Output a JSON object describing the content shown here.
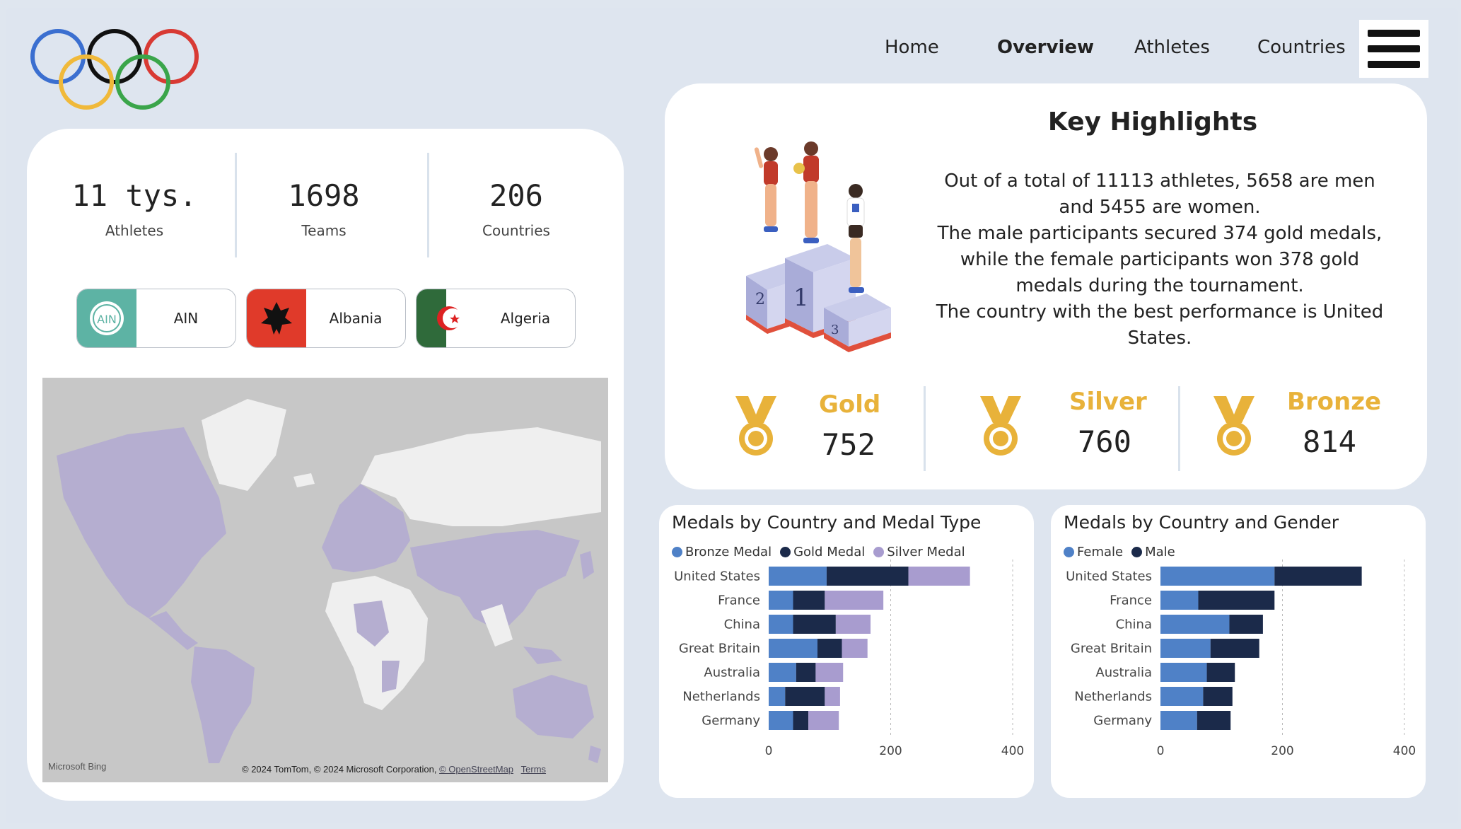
{
  "nav": {
    "items": [
      {
        "label": "Home",
        "active": false
      },
      {
        "label": "Overview",
        "active": true
      },
      {
        "label": "Athletes",
        "active": false
      },
      {
        "label": "Countries",
        "active": false
      }
    ]
  },
  "kpis": [
    {
      "value": "11 tys.",
      "label": "Athletes"
    },
    {
      "value": "1698",
      "label": "Teams"
    },
    {
      "value": "206",
      "label": "Countries"
    }
  ],
  "country_chips": [
    {
      "name": "AIN",
      "flag_color": "#5db3a4"
    },
    {
      "name": "Albania",
      "flag_color": "#e03a2a"
    },
    {
      "name": "Algeria",
      "flag_color": "#2f6a3a"
    }
  ],
  "map": {
    "provider": "Microsoft Bing",
    "attribution": "© 2024 TomTom, © 2024 Microsoft Corporation,",
    "osm_link": "© OpenStreetMap",
    "terms_link": "Terms"
  },
  "highlights": {
    "title": "Key Highlights",
    "lines": [
      "Out of a total of 11113 athletes, 5658 are men and 5455 are women.",
      "The male participants secured 374 gold medals, while the female participants won 378 gold medals during the tournament.",
      "The country with the best performance is United States."
    ],
    "medals": [
      {
        "label": "Gold",
        "value": "752"
      },
      {
        "label": "Silver",
        "value": "760"
      },
      {
        "label": "Bronze",
        "value": "814"
      }
    ]
  },
  "colors": {
    "bronze_medal": "#4f81c7",
    "gold_medal": "#1b2a4a",
    "silver_medal": "#a89ccf",
    "female": "#4f81c7",
    "male": "#1b2a4a",
    "medal_label": "#e8b23a",
    "map_land": "#efefef",
    "map_highlight": "#b5aed0"
  },
  "chart_data": [
    {
      "type": "bar",
      "orientation": "horizontal",
      "stacked": true,
      "title": "Medals by Country and Medal Type",
      "categories": [
        "United States",
        "France",
        "China",
        "Great Britain",
        "Australia",
        "Netherlands",
        "Germany"
      ],
      "series": [
        {
          "name": "Bronze Medal",
          "values": [
            95,
            40,
            40,
            80,
            45,
            27,
            40
          ]
        },
        {
          "name": "Gold Medal",
          "values": [
            134,
            52,
            70,
            40,
            32,
            65,
            25
          ]
        },
        {
          "name": "Silver Medal",
          "values": [
            101,
            96,
            57,
            42,
            45,
            25,
            50
          ]
        }
      ],
      "xlim": [
        0,
        400
      ],
      "xticks": [
        "0",
        "200",
        "400"
      ],
      "legend": "top-left",
      "grid": true
    },
    {
      "type": "bar",
      "orientation": "horizontal",
      "stacked": true,
      "title": "Medals by Country and Gender",
      "categories": [
        "United States",
        "France",
        "China",
        "Great Britain",
        "Australia",
        "Netherlands",
        "Germany"
      ],
      "series": [
        {
          "name": "Female",
          "values": [
            187,
            62,
            113,
            82,
            76,
            70,
            60
          ]
        },
        {
          "name": "Male",
          "values": [
            143,
            125,
            55,
            80,
            46,
            48,
            55
          ]
        }
      ],
      "xlim": [
        0,
        400
      ],
      "xticks": [
        "0",
        "200",
        "400"
      ],
      "legend": "top-left",
      "grid": true
    }
  ]
}
